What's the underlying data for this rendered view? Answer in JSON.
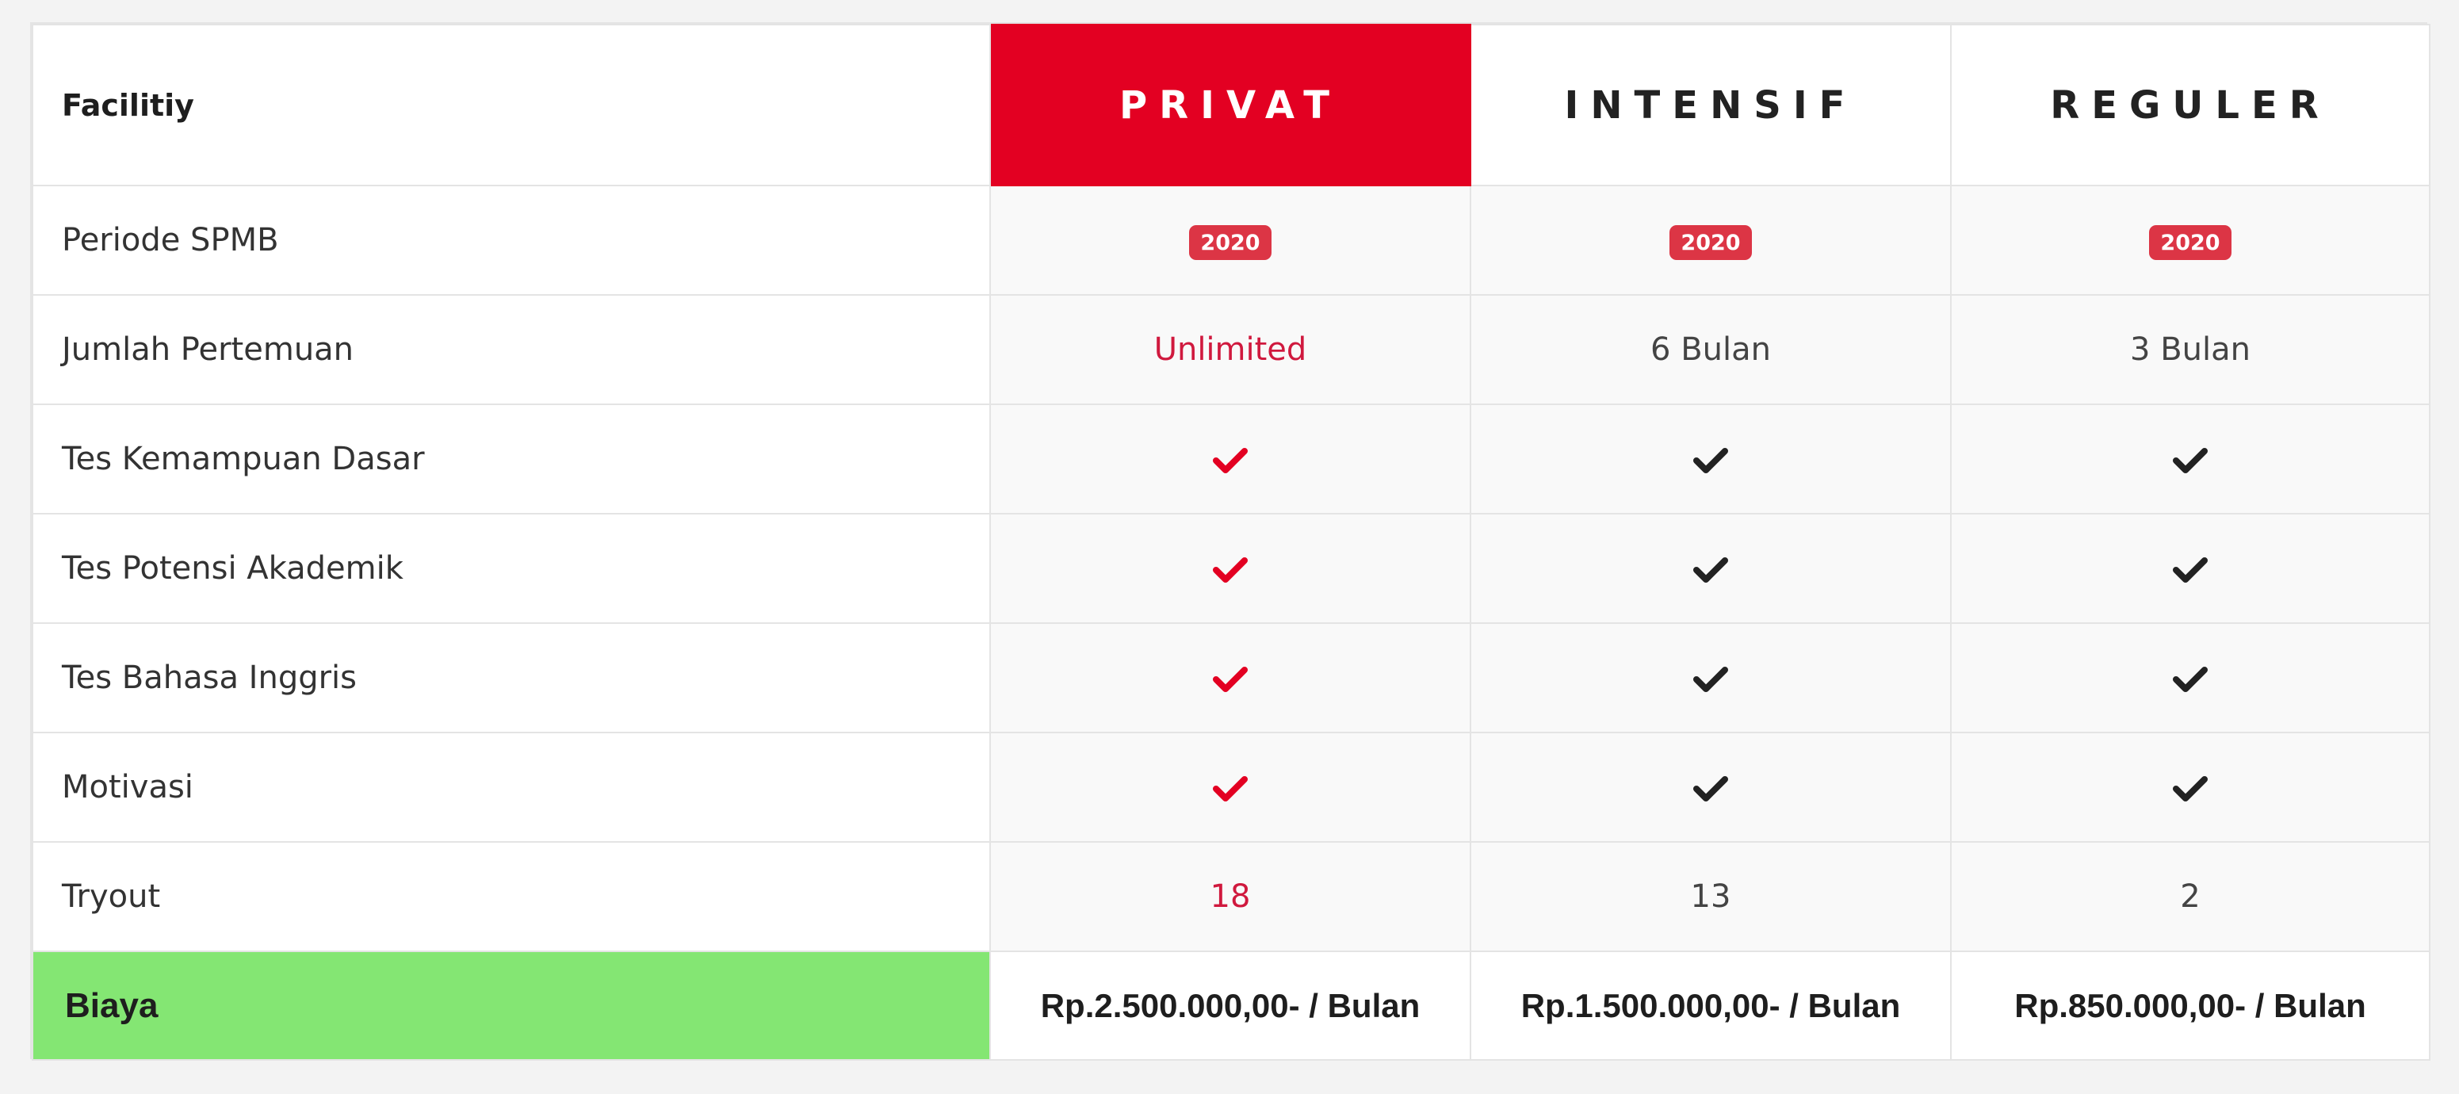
{
  "table": {
    "facility_header": "Facilitiy",
    "plans": [
      {
        "name": "PRIVAT",
        "featured": true
      },
      {
        "name": "INTENSIF",
        "featured": false
      },
      {
        "name": "REGULER",
        "featured": false
      }
    ],
    "rows": [
      {
        "label": "Periode SPMB",
        "values": [
          "2020",
          "2020",
          "2020"
        ],
        "kind": "badge"
      },
      {
        "label": "Jumlah Pertemuan",
        "values": [
          "Unlimited",
          "6 Bulan",
          "3 Bulan"
        ],
        "kind": "text"
      },
      {
        "label": "Tes Kemampuan Dasar",
        "values": [
          "check",
          "check",
          "check"
        ],
        "kind": "check-icon"
      },
      {
        "label": "Tes Potensi Akademik",
        "values": [
          "check",
          "check",
          "check"
        ],
        "kind": "check-icon"
      },
      {
        "label": "Tes Bahasa Inggris",
        "values": [
          "check",
          "check",
          "check"
        ],
        "kind": "check-icon"
      },
      {
        "label": "Motivasi",
        "values": [
          "check",
          "check",
          "check"
        ],
        "kind": "check-icon"
      },
      {
        "label": "Tryout",
        "values": [
          "18",
          "13",
          "2"
        ],
        "kind": "text"
      }
    ],
    "footer": {
      "label": "Biaya",
      "prices": [
        "Rp.2.500.000,00- / Bulan",
        "Rp.1.500.000,00- / Bulan",
        "Rp.850.000,00- / Bulan"
      ]
    }
  },
  "colors": {
    "featured_header": "#e30022",
    "featured_text": "#d0193e",
    "badge": "#dc3545",
    "check_featured": "#e30022",
    "check_default": "#222222",
    "footer_label_bg": "#84e673"
  }
}
